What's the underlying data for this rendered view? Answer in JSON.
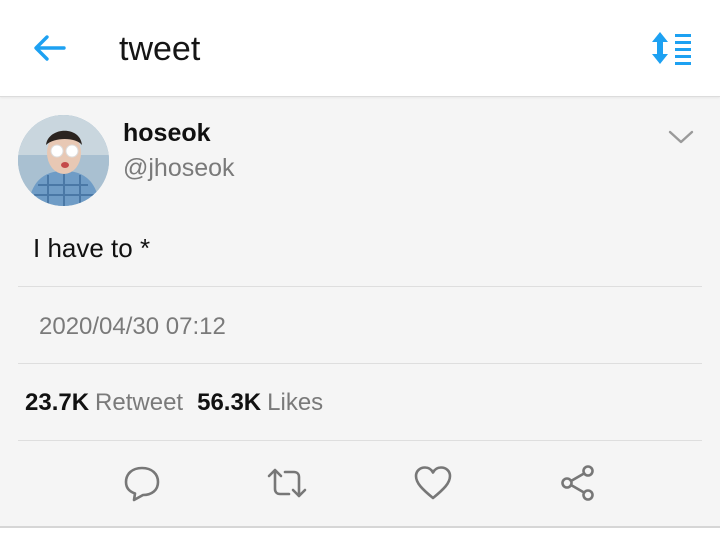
{
  "header": {
    "title": "tweet",
    "back_icon": "arrow-left-icon",
    "sort_icon": "sort-list-icon",
    "accent_color": "#1da1f2"
  },
  "tweet": {
    "display_name": "hoseok",
    "handle": "@jhoseok",
    "menu_icon": "chevron-down-icon",
    "text": "I have to *",
    "timestamp": "2020/04/30 07:12"
  },
  "stats": {
    "retweets_count": "23.7K",
    "retweets_label": "Retweet",
    "likes_count": "56.3K",
    "likes_label": "Likes"
  },
  "actions": [
    {
      "icon": "reply-icon"
    },
    {
      "icon": "retweet-icon"
    },
    {
      "icon": "heart-icon"
    },
    {
      "icon": "share-icon"
    }
  ],
  "colors": {
    "icon_gray": "#777777",
    "text_secondary": "#7a7a7a",
    "background": "#f5f5f5"
  }
}
